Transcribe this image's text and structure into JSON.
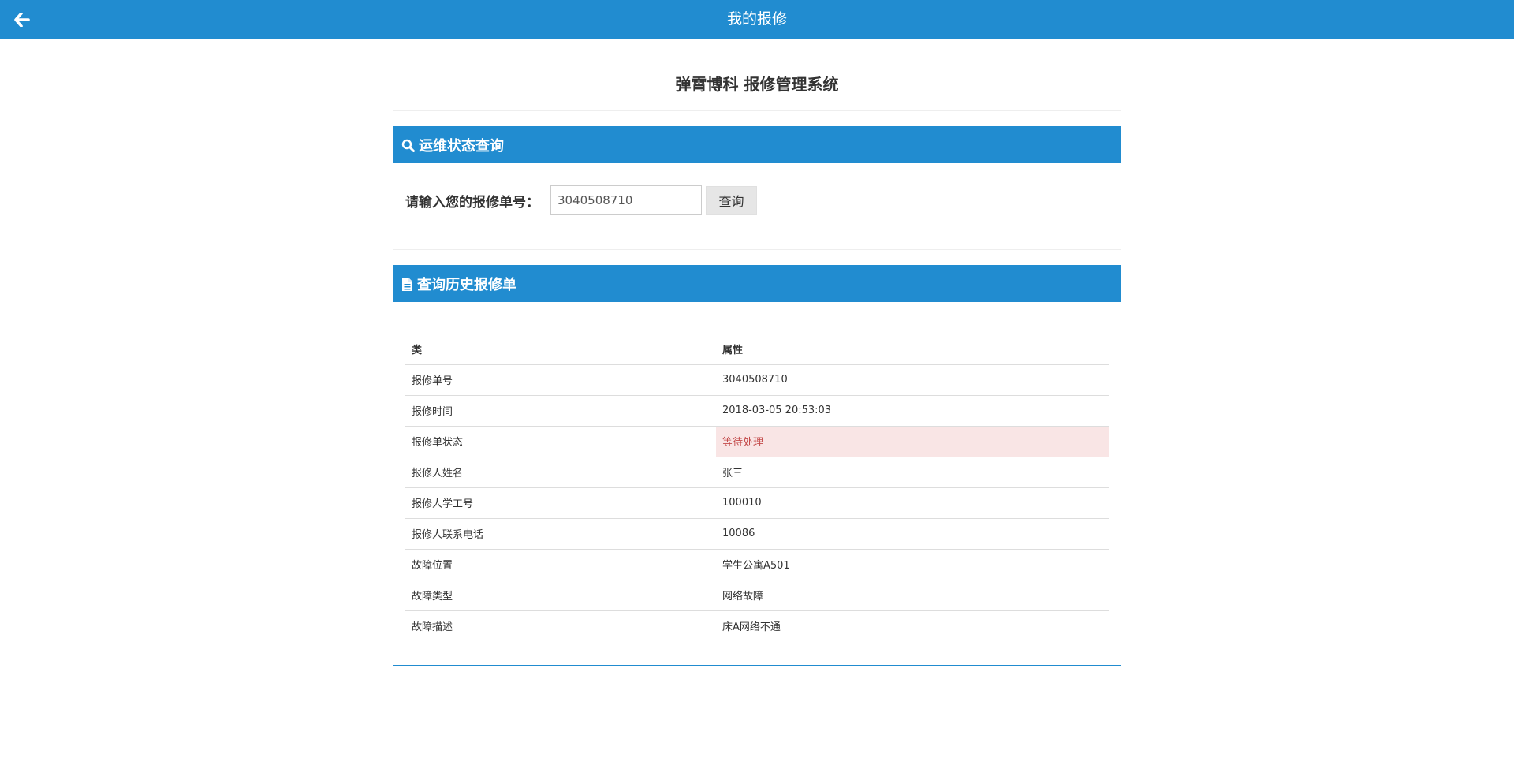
{
  "header": {
    "title": "我的报修",
    "back_icon": "arrow-left-icon",
    "bg_color": "#218cd0"
  },
  "main": {
    "title": "弹霄博科 报修管理系统"
  },
  "search_panel": {
    "heading": "运维状态查询",
    "icon": "search-icon",
    "label": "请输入您的报修单号：",
    "input_value": "3040508710",
    "button_label": "查询"
  },
  "history_panel": {
    "heading": "查询历史报修单",
    "icon": "document-icon",
    "columns": [
      "类",
      "属性"
    ],
    "rows": [
      {
        "key": "报修单号",
        "value": "3040508710",
        "highlight": false
      },
      {
        "key": "报修时间",
        "value": "2018-03-05 20:53:03",
        "highlight": false
      },
      {
        "key": "报修单状态",
        "value": "等待处理",
        "highlight": true
      },
      {
        "key": "报修人姓名",
        "value": "张三",
        "highlight": false
      },
      {
        "key": "报修人学工号",
        "value": "100010",
        "highlight": false
      },
      {
        "key": "报修人联系电话",
        "value": "10086",
        "highlight": false
      },
      {
        "key": "故障位置",
        "value": "学生公寓A501",
        "highlight": false
      },
      {
        "key": "故障类型",
        "value": "网络故障",
        "highlight": false
      },
      {
        "key": "故障描述",
        "value": "床A网络不通",
        "highlight": false
      }
    ],
    "highlight_color": "#c44a4a"
  }
}
